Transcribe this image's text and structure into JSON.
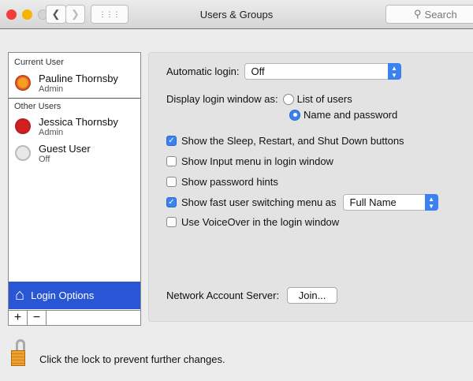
{
  "window": {
    "title": "Users & Groups",
    "search_placeholder": "Search"
  },
  "sidebar": {
    "current_header": "Current User",
    "other_header": "Other Users",
    "users": [
      {
        "name": "Pauline Thornsby",
        "role": "Admin"
      },
      {
        "name": "Jessica Thornsby",
        "role": "Admin"
      },
      {
        "name": "Guest User",
        "role": "Off"
      }
    ],
    "login_options": "Login Options",
    "add": "+",
    "remove": "−"
  },
  "main": {
    "automatic_login_label": "Automatic login:",
    "automatic_login_value": "Off",
    "display_label": "Display login window as:",
    "radio_list": "List of users",
    "radio_name": "Name and password",
    "radio_selected": "Name and password",
    "checks": [
      {
        "label": "Show the Sleep, Restart, and Shut Down buttons",
        "checked": true
      },
      {
        "label": "Show Input menu in login window",
        "checked": false
      },
      {
        "label": "Show password hints",
        "checked": false
      },
      {
        "label": "Show fast user switching menu as",
        "checked": true
      },
      {
        "label": "Use VoiceOver in the login window",
        "checked": false
      }
    ],
    "fast_switch_value": "Full Name",
    "network_label": "Network Account Server:",
    "join_button": "Join..."
  },
  "footer": {
    "lock_text": "Click the lock to prevent further changes."
  },
  "colors": {
    "accent": "#2956d4",
    "checkbox": "#3b82f0"
  }
}
